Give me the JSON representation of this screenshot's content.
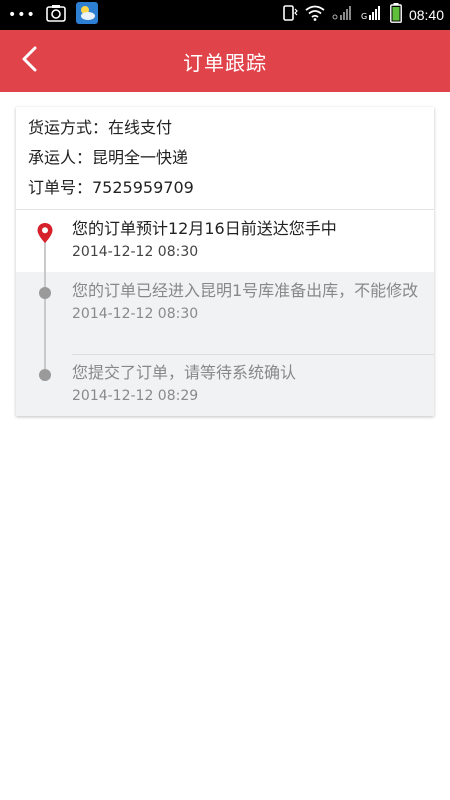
{
  "status_bar": {
    "time": "08:40",
    "dots": "•••"
  },
  "header": {
    "title": "订单跟踪"
  },
  "order": {
    "shipping_method": "货运方式：在线支付",
    "carrier": "承运人：昆明全一快递",
    "order_number": "订单号：7525959709"
  },
  "timeline": [
    {
      "text": "您的订单预计12月16日前送达您手中",
      "time": "2014-12-12  08:30",
      "state": "current"
    },
    {
      "text": "您的订单已经进入昆明1号库准备出库，不能修改",
      "time": "2014-12-12  08:30",
      "state": "past"
    },
    {
      "text": "您提交了订单，请等待系统确认",
      "time": "2014-12-12  08:29",
      "state": "past"
    }
  ],
  "colors": {
    "header": "#e0434a",
    "pin": "#d6202a",
    "dot": "#9a9a9a",
    "past_bg": "#f1f2f4"
  }
}
